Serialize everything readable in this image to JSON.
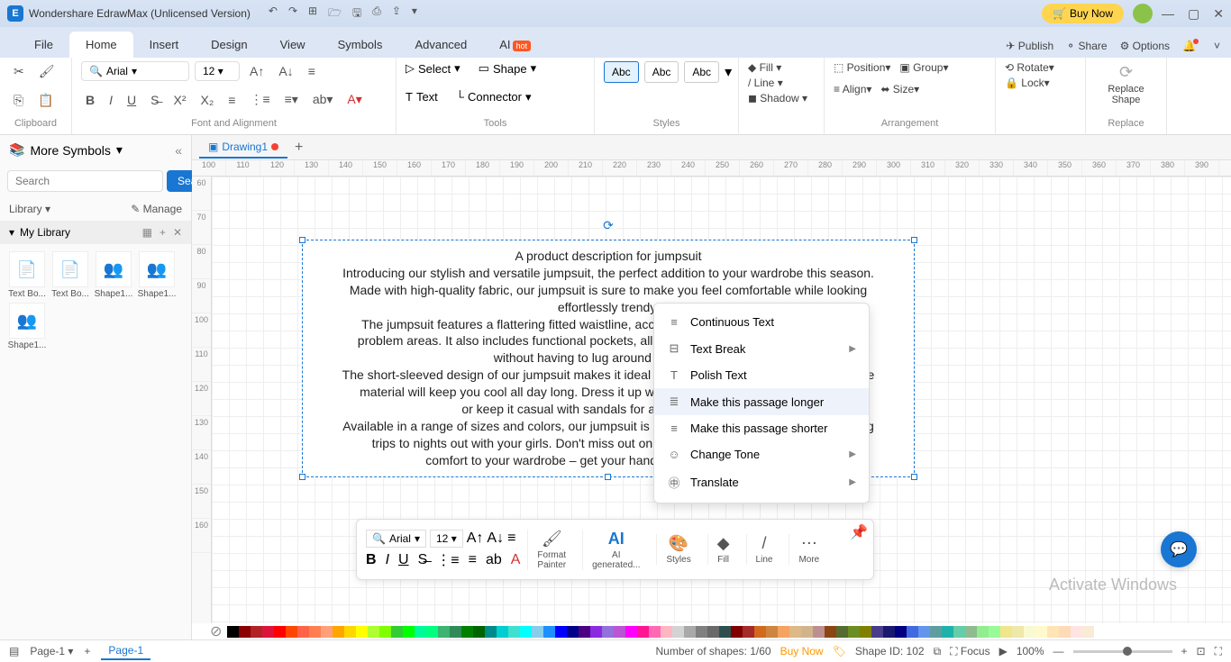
{
  "title": "Wondershare EdrawMax (Unlicensed Version)",
  "buyNow": "Buy Now",
  "menu": {
    "file": "File",
    "home": "Home",
    "insert": "Insert",
    "design": "Design",
    "view": "View",
    "symbols": "Symbols",
    "advanced": "Advanced",
    "ai": "AI",
    "hot": "hot",
    "publish": "Publish",
    "share": "Share",
    "options": "Options"
  },
  "ribbon": {
    "clipboard": "Clipboard",
    "fontAlign": "Font and Alignment",
    "tools": "Tools",
    "styles": "Styles",
    "arrange": "Arrangement",
    "replace": "Replace",
    "font": "Arial",
    "size": "12",
    "select": "Select",
    "shape": "Shape",
    "text": "Text",
    "connector": "Connector",
    "abc": "Abc",
    "fill": "Fill",
    "line": "Line",
    "shadow": "Shadow",
    "position": "Position",
    "align": "Align",
    "group": "Group",
    "sizeBtn": "Size",
    "rotate": "Rotate",
    "lock": "Lock",
    "replaceShape": "Replace\nShape"
  },
  "sidebar": {
    "title": "More Symbols",
    "search": "Search",
    "searchPh": "Search",
    "library": "Library",
    "manage": "Manage",
    "mylib": "My Library",
    "items": [
      "Text Bo...",
      "Text Bo...",
      "Shape1...",
      "Shape1...",
      "Shape1..."
    ]
  },
  "doc": {
    "name": "Drawing1"
  },
  "rulerH": [
    "100",
    "110",
    "120",
    "130",
    "140",
    "150",
    "160",
    "170",
    "180",
    "190",
    "200",
    "210",
    "220",
    "230",
    "240",
    "250",
    "260",
    "270",
    "280",
    "290",
    "300",
    "310",
    "320",
    "330",
    "340",
    "350",
    "360",
    "370",
    "380",
    "390"
  ],
  "rulerV": [
    "60",
    "70",
    "80",
    "90",
    "100",
    "110",
    "120",
    "130",
    "140",
    "150",
    "160"
  ],
  "textbox": {
    "l1": "A product description for jumpsuit",
    "l2": "Introducing our stylish and versatile jumpsuit, the perfect addition to your wardrobe this season.",
    "l3": "Made with high-quality fabric, our jumpsuit is sure to make you feel comfortable while looking",
    "l4": "effortlessly trendy.",
    "l5": "The jumpsuit features a flattering fitted waistline, accentuating your figure and hiding any",
    "l6": "problem areas. It also includes functional pockets, allowing you to carry all your essentials",
    "l7": "without having to lug around a bulky bag.",
    "l8": "The short-sleeved design of our jumpsuit makes it ideal for warmer weather, and the breathable",
    "l9": "material will keep you cool all day long. Dress it up with a pair of heels for a chic night out",
    "l10": "or keep it casual with sandals for a weekend brunch.",
    "l11": "Available in a range of sizes and colors, our jumpsuit is perfect for any occasion, from shopping",
    "l12": "trips to nights out with your girls. Don't miss out on the chance to add some style and",
    "l13": "comfort to your wardrobe – get your hands on our jumpsuit today!"
  },
  "ctx": {
    "continuous": "Continuous Text",
    "break": "Text Break",
    "polish": "Polish Text",
    "longer": "Make this passage longer",
    "shorter": "Make this passage shorter",
    "tone": "Change Tone",
    "translate": "Translate"
  },
  "float": {
    "font": "Arial",
    "size": "12",
    "painter": "Format\nPainter",
    "ai": "AI\ngenerated...",
    "styles": "Styles",
    "fill": "Fill",
    "line": "Line",
    "more": "More"
  },
  "colors": [
    "#000000",
    "#8B0000",
    "#B22222",
    "#DC143C",
    "#FF0000",
    "#FF4500",
    "#FF6347",
    "#FF7F50",
    "#FFA07A",
    "#FFA500",
    "#FFD700",
    "#FFFF00",
    "#ADFF2F",
    "#7FFF00",
    "#32CD32",
    "#00FF00",
    "#00FA9A",
    "#00FF7F",
    "#3CB371",
    "#2E8B57",
    "#008000",
    "#006400",
    "#008B8B",
    "#00CED1",
    "#40E0D0",
    "#00FFFF",
    "#87CEEB",
    "#1E90FF",
    "#0000FF",
    "#00008B",
    "#4B0082",
    "#8A2BE2",
    "#9370DB",
    "#BA55D3",
    "#FF00FF",
    "#FF1493",
    "#FF69B4",
    "#FFB6C1",
    "#D3D3D3",
    "#A9A9A9",
    "#808080",
    "#696969",
    "#2F4F4F",
    "#800000",
    "#A52A2A",
    "#D2691E",
    "#CD853F",
    "#F4A460",
    "#DEB887",
    "#D2B48C",
    "#BC8F8F",
    "#8B4513",
    "#556B2F",
    "#6B8E23",
    "#808000",
    "#483D8B",
    "#191970",
    "#000080",
    "#4169E1",
    "#6495ED",
    "#5F9EA0",
    "#20B2AA",
    "#66CDAA",
    "#8FBC8F",
    "#90EE90",
    "#98FB98",
    "#F0E68C",
    "#EEE8AA",
    "#FAFAD2",
    "#FFFACD",
    "#FFE4B5",
    "#FFDAB9",
    "#FFE4E1",
    "#FAEBD7"
  ],
  "status": {
    "page": "Page-1",
    "shapes": "Number of shapes: 1/60",
    "buy": "Buy Now",
    "shapeId": "Shape ID: 102",
    "focus": "Focus",
    "zoom": "100%"
  },
  "watermark": "Activate Windows"
}
